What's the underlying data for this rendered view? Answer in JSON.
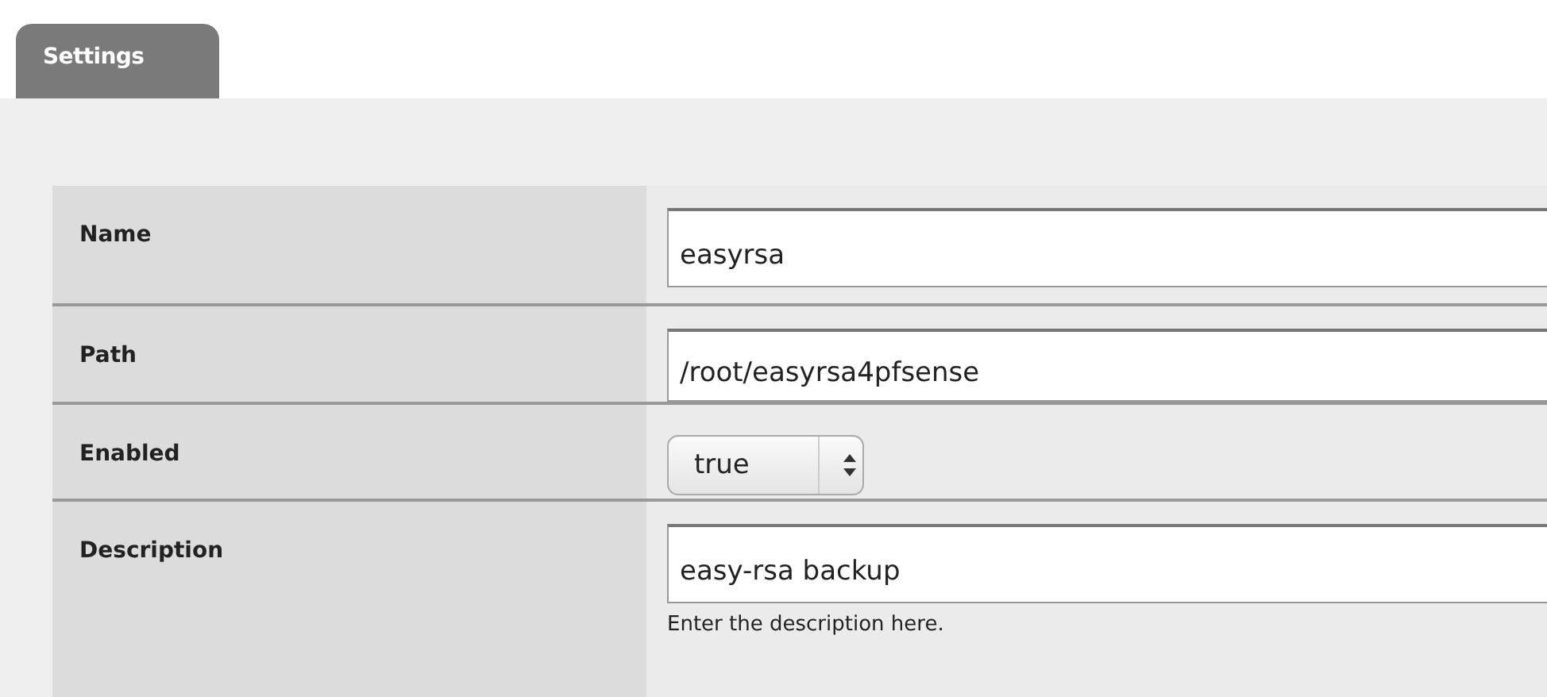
{
  "tabs": [
    {
      "label": "Settings",
      "selected": true
    }
  ],
  "fields": [
    {
      "kind": "text",
      "label": "Name",
      "value": "easyrsa"
    },
    {
      "kind": "text",
      "label": "Path",
      "value": "/root/easyrsa4pfsense"
    },
    {
      "kind": "select",
      "label": "Enabled",
      "value": "true"
    },
    {
      "kind": "text",
      "label": "Description",
      "value": "easy-rsa backup",
      "help": "Enter the description here."
    }
  ]
}
